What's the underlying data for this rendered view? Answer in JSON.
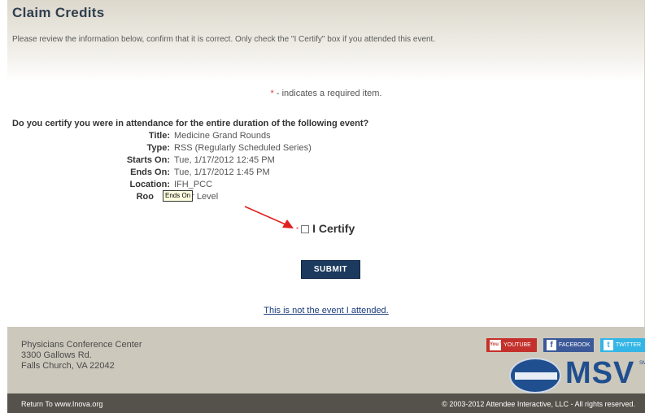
{
  "page": {
    "title": "Claim Credits",
    "intro": "Please review the information below, confirm that it is correct. Only check the \"I Certify\" box if you attended this event.",
    "required_star": "*",
    "required_text": " - indicates a required item."
  },
  "event": {
    "question": "Do you certify you were in attendance for the entire duration of the following event?",
    "details": [
      {
        "label": "Title:",
        "value": "Medicine Grand Rounds"
      },
      {
        "label": "Type:",
        "value": "RSS (Regularly Scheduled Series)"
      },
      {
        "label": "Starts On:",
        "value": "Tue, 1/17/2012 12:45 PM"
      },
      {
        "label": "Ends On:",
        "value": "Tue, 1/17/2012 1:45 PM"
      },
      {
        "label": "Location:",
        "value": "IFH_PCC"
      },
      {
        "label": "Roo",
        "value": "er Level"
      }
    ],
    "tooltip": "Ends On"
  },
  "form": {
    "certify_star": "*",
    "certify_label": "I Certify",
    "checked": false,
    "submit_label": "SUBMIT",
    "not_event_link": "This is not the event I attended."
  },
  "footer": {
    "address": [
      "Physicians Conference Center",
      "3300 Gallows Rd.",
      "Falls Church, VA 22042"
    ],
    "social": [
      {
        "label": "YOUTUBE",
        "icon": "youtube-icon",
        "mark": "You Tube"
      },
      {
        "label": "FACEBOOK",
        "icon": "facebook-icon",
        "mark": "f"
      },
      {
        "label": "TWITTER",
        "icon": "twitter-icon",
        "mark": "t"
      }
    ],
    "logo_text": "MSV",
    "logo_sm": "SM",
    "return_link": "Return To www.Inova.org",
    "copyright": "© 2003-2012 Attendee Interactive, LLC - All rights reserved."
  },
  "colors": {
    "submit": "#1c3a5e",
    "footer": "#cdc8bc",
    "bottom_bar": "#55524b",
    "accent_red": "#e04040",
    "link": "#1a3a7a"
  }
}
